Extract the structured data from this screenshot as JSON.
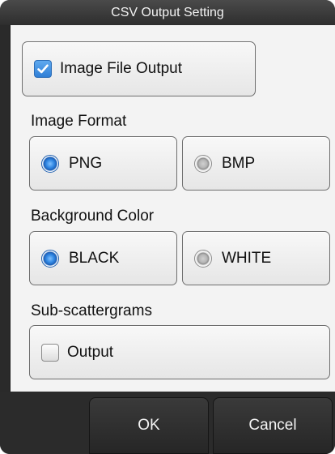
{
  "dialog": {
    "title": "CSV Output Setting"
  },
  "image_file_output": {
    "label": "Image File Output",
    "checked": true
  },
  "image_format": {
    "heading": "Image Format",
    "options": [
      {
        "label": "PNG",
        "selected": true
      },
      {
        "label": "BMP",
        "selected": false
      }
    ]
  },
  "background_color": {
    "heading": "Background Color",
    "options": [
      {
        "label": "BLACK",
        "selected": true
      },
      {
        "label": "WHITE",
        "selected": false
      }
    ]
  },
  "sub_scattergrams": {
    "heading": "Sub-scattergrams",
    "output_label": "Output",
    "checked": false
  },
  "footer": {
    "ok_label": "OK",
    "cancel_label": "Cancel"
  },
  "colors": {
    "accent_blue": "#2f7fd6",
    "dark_chrome": "#2b2b2b",
    "panel": "#f3f3f3"
  }
}
